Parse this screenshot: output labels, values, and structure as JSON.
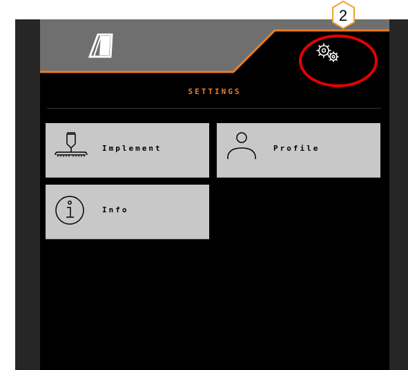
{
  "header": {
    "settings_icon": "gears-icon",
    "logo_icon": "implement-logo-icon",
    "accent_color": "#ee7d22",
    "bar_color": "#6f6f6f"
  },
  "page": {
    "title": "SETTINGS"
  },
  "tiles": [
    {
      "label": "Implement",
      "icon": "implement-icon"
    },
    {
      "label": "Profile",
      "icon": "profile-icon"
    },
    {
      "label": "Info",
      "icon": "info-icon"
    }
  ],
  "callout": {
    "number": "2",
    "highlight_color": "#e60000",
    "badge_border_color": "#f0a030"
  }
}
